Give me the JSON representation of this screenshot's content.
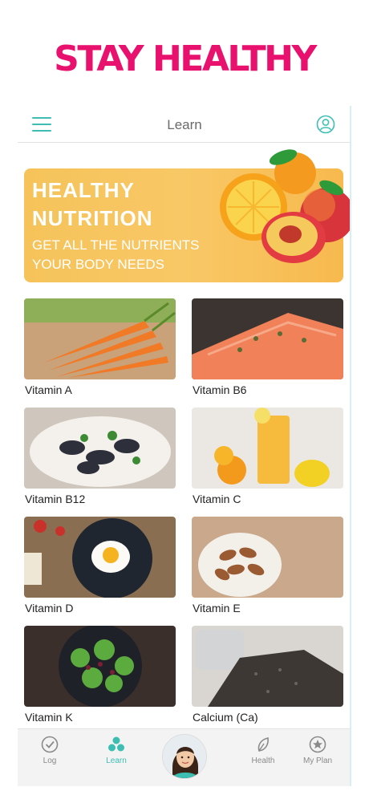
{
  "promo": {
    "headline": "STAY HEALTHY"
  },
  "header": {
    "title": "Learn"
  },
  "banner": {
    "title_line1": "HEALTHY",
    "title_line2": "NUTRITION",
    "subtitle_line1": "GET ALL THE NUTRIENTS",
    "subtitle_line2": "YOUR BODY NEEDS"
  },
  "cards": [
    {
      "label": "Vitamin A"
    },
    {
      "label": "Vitamin B6"
    },
    {
      "label": "Vitamin B12"
    },
    {
      "label": "Vitamin C"
    },
    {
      "label": "Vitamin D"
    },
    {
      "label": "Vitamin E"
    },
    {
      "label": "Vitamin K"
    },
    {
      "label": "Calcium (Ca)"
    }
  ],
  "tabbar": {
    "items": [
      {
        "label": "Log",
        "icon": "check-circle-icon"
      },
      {
        "label": "Learn",
        "icon": "dots-cluster-icon",
        "active": true
      },
      {
        "label": "",
        "icon": "profile-avatar"
      },
      {
        "label": "Health",
        "icon": "leaf-icon"
      },
      {
        "label": "My Plan",
        "icon": "star-circle-icon"
      }
    ]
  },
  "colors": {
    "accent": "#3cbfb2",
    "promo": "#e8116e",
    "banner": "#f7c25a"
  }
}
